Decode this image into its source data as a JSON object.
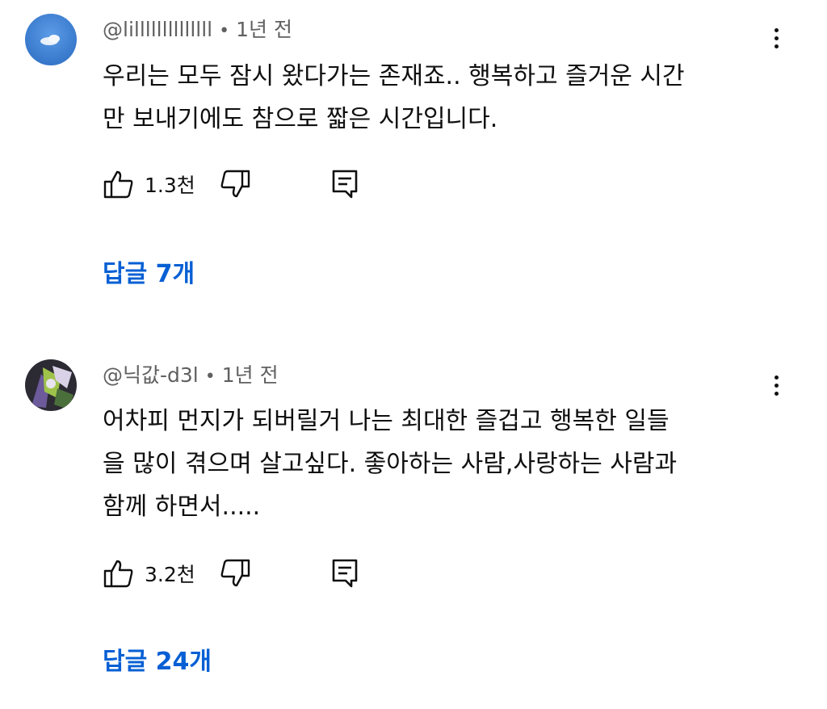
{
  "colors": {
    "link_blue": "#065fd4",
    "meta_gray": "#606060",
    "text": "#0f0f0f"
  },
  "comments": [
    {
      "handle": "@lillllllllllllll",
      "separator": "•",
      "time": "1년 전",
      "text_lines": [
        "우리는 모두 잠시 왔다가는 존재죠.. 행복하고 즐거운 시간",
        "만 보내기에도 참으로 짧은 시간입니다."
      ],
      "like_count": "1.3천",
      "replies_label": "답글 7개",
      "icons": [
        "avatar",
        "more-vert-icon",
        "thumb-up-icon",
        "thumb-down-icon",
        "reply-comment-icon"
      ]
    },
    {
      "handle": "@닉값-d3l",
      "separator": "•",
      "time": "1년 전",
      "text_lines": [
        "어차피 먼지가 되버릴거 나는 최대한 즐겁고 행복한 일들",
        "을 많이 겪으며 살고싶다. 좋아하는 사람,사랑하는 사람과",
        "함께 하면서....."
      ],
      "like_count": "3.2천",
      "replies_label": "답글 24개",
      "icons": [
        "avatar",
        "more-vert-icon",
        "thumb-up-icon",
        "thumb-down-icon",
        "reply-comment-icon"
      ]
    }
  ]
}
